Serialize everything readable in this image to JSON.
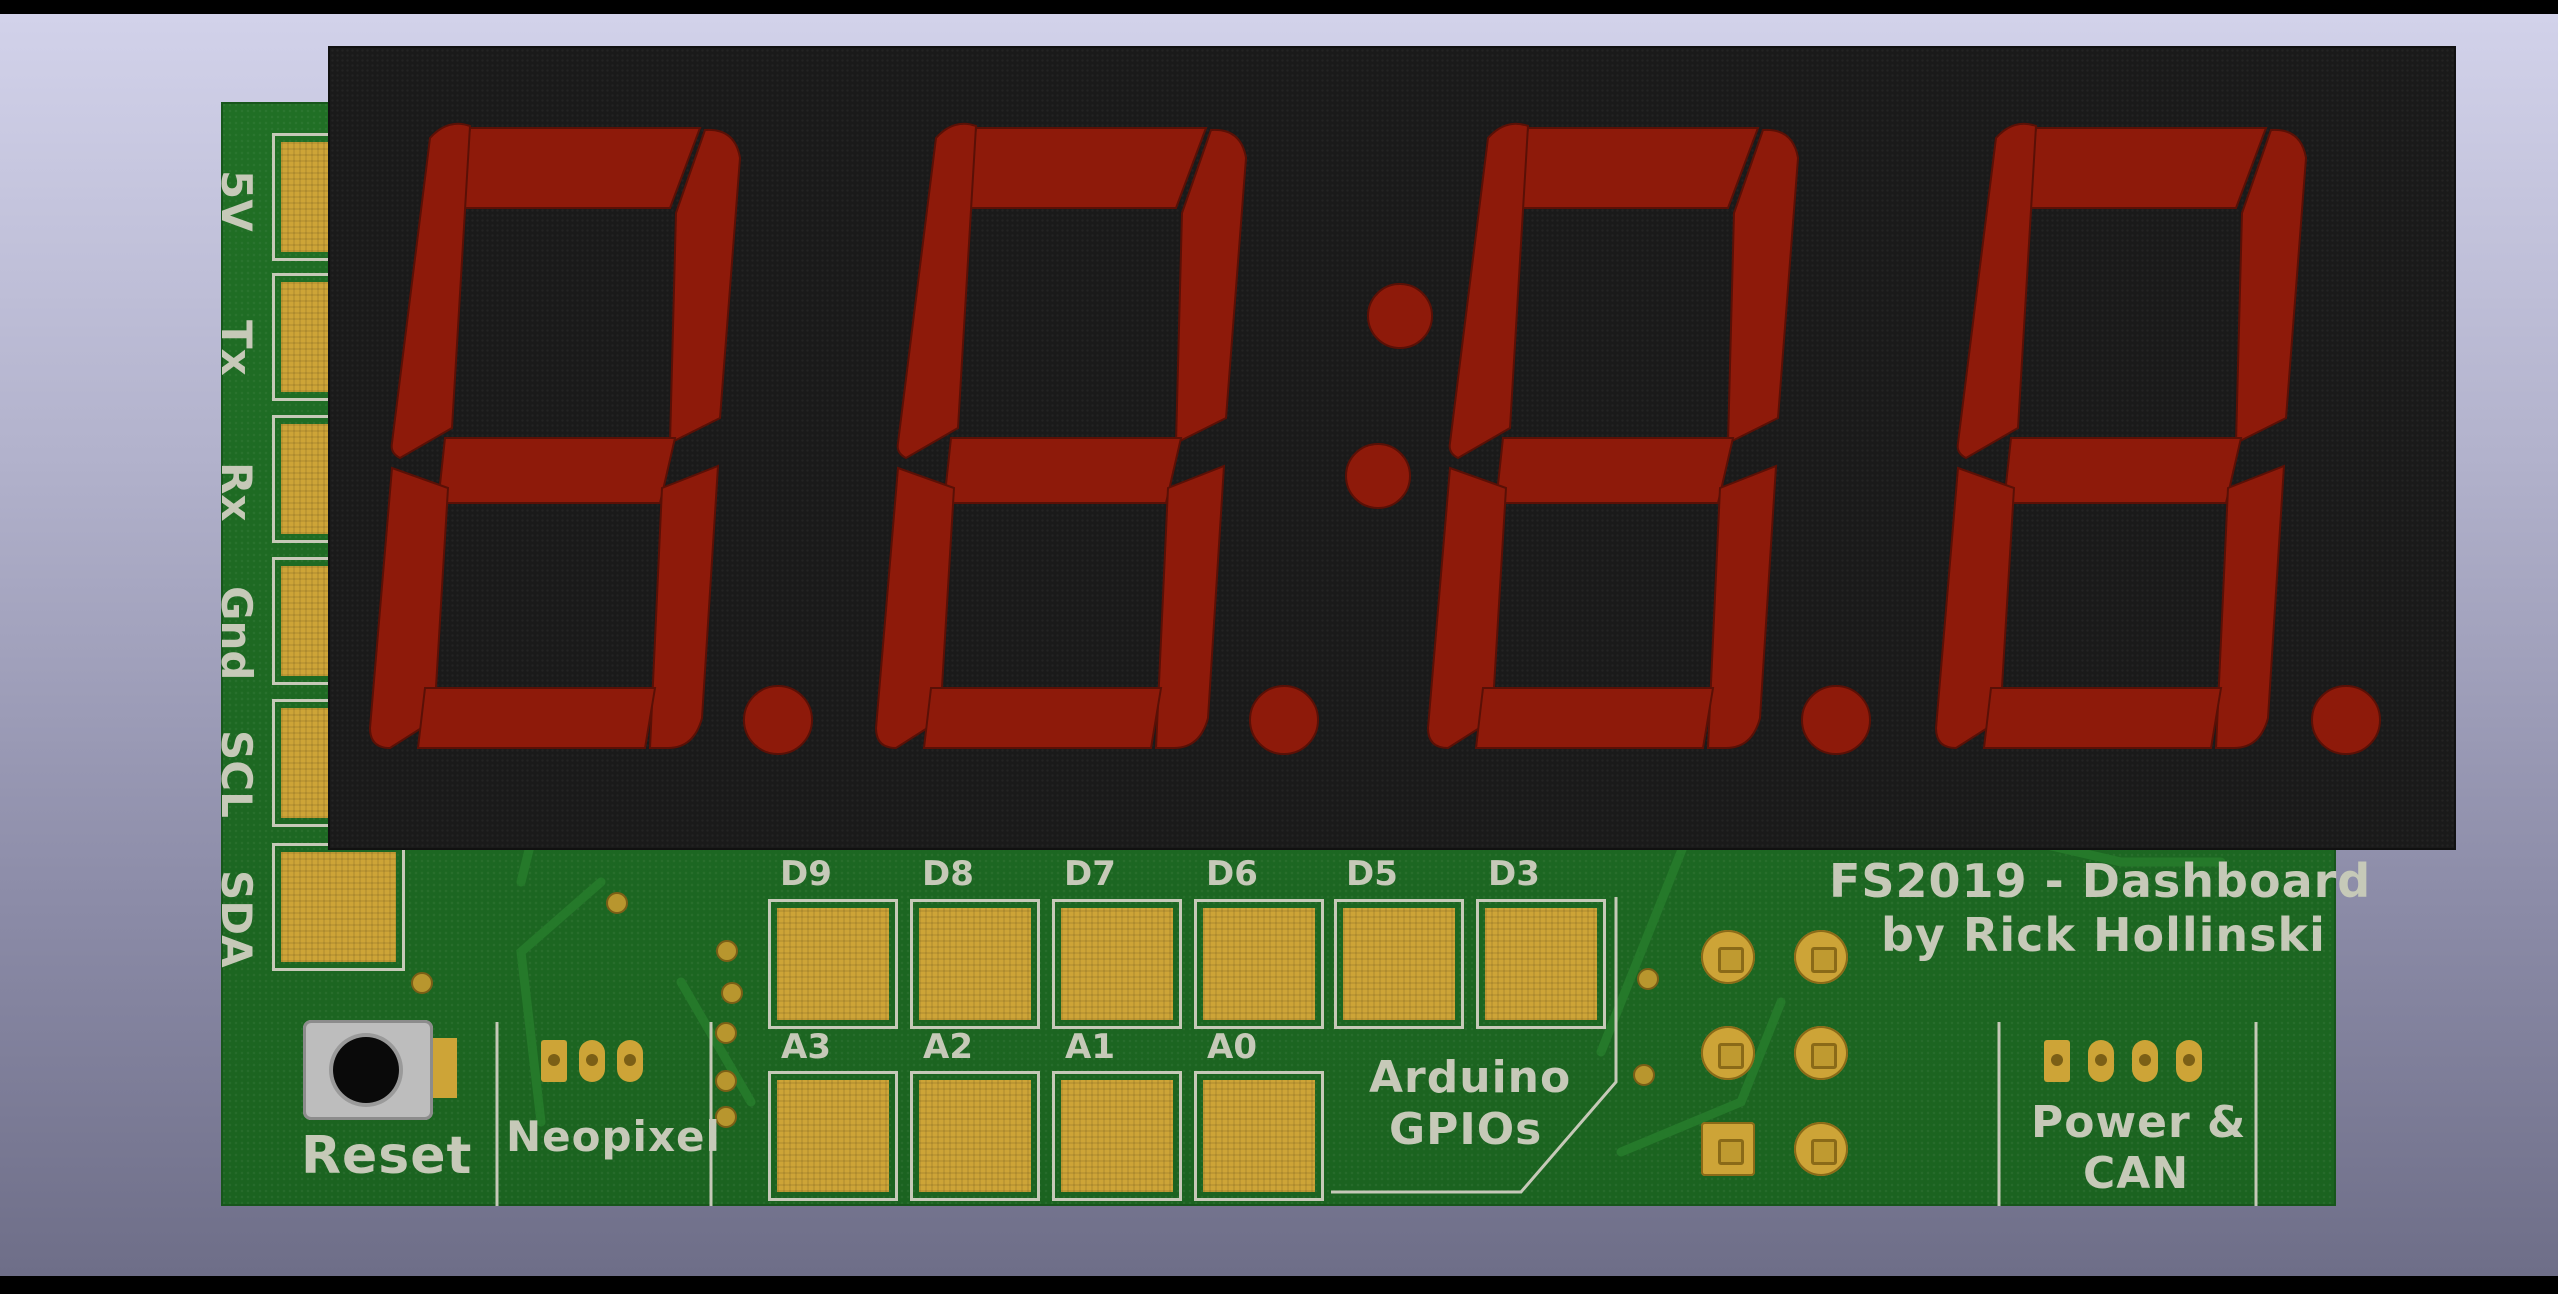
{
  "board": {
    "title_line1": "FS2019 - Dashboard",
    "title_line2": "by Rick Hollinski",
    "reset_label": "Reset",
    "neopixel_label": "Neopixel",
    "gpio_label_line1": "Arduino",
    "gpio_label_line2": "GPIOs",
    "power_label_line1": "Power &",
    "power_label_line2": "CAN",
    "side_pins": [
      "5V",
      "Tx",
      "Rx",
      "Gnd",
      "SCL",
      "SDA"
    ],
    "digital_pads": [
      "D9",
      "D8",
      "D7",
      "D6",
      "D5",
      "D3"
    ],
    "analog_pads": [
      "A3",
      "A2",
      "A1",
      "A0"
    ]
  },
  "display": {
    "digits": 4,
    "segment_color": "#8e1a0a",
    "body_color": "#1a1a1a"
  },
  "colors": {
    "pcb": "#1d6b22",
    "copper": "#cda437",
    "silkscreen": "#c6c9b8"
  }
}
